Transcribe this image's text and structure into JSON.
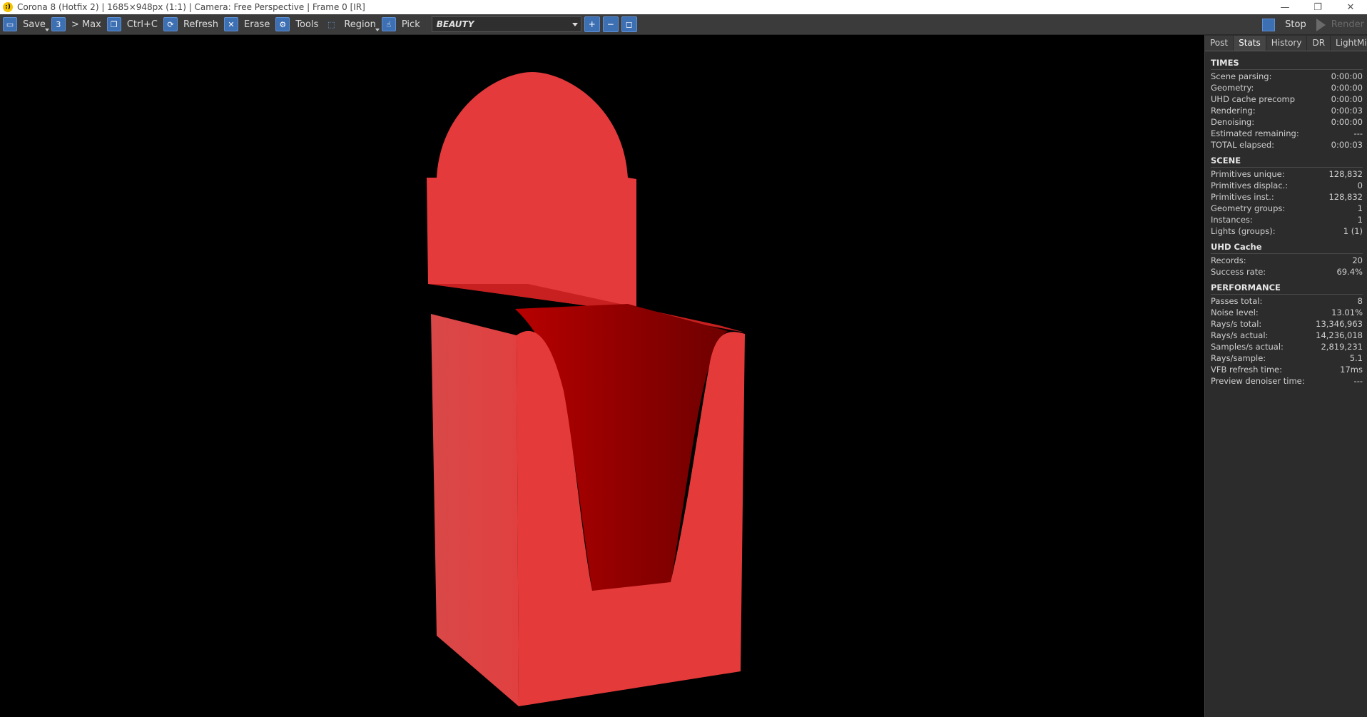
{
  "window": {
    "title": "Corona 8 (Hotfix 2) | 1685×948px (1:1) | Camera: Free Perspective | Frame 0 [IR]",
    "app_icon_glyph": ":)",
    "minimize": "—",
    "restore": "❐",
    "close": "✕"
  },
  "toolbar": {
    "save": "Save",
    "max": "> Max",
    "copy": "Ctrl+C",
    "refresh": "Refresh",
    "erase": "Erase",
    "tools": "Tools",
    "region": "Region",
    "pick": "Pick",
    "render_pass": "BEAUTY",
    "stop": "Stop",
    "render": "Render"
  },
  "tabs": [
    "Post",
    "Stats",
    "History",
    "DR",
    "LightMix"
  ],
  "active_tab": "Stats",
  "stats": {
    "times": {
      "title": "TIMES",
      "rows": [
        {
          "label": "Scene parsing:",
          "value": "0:00:00"
        },
        {
          "label": "Geometry:",
          "value": "0:00:00"
        },
        {
          "label": "UHD cache precomp",
          "value": "0:00:00"
        },
        {
          "label": "Rendering:",
          "value": "0:00:03"
        },
        {
          "label": "Denoising:",
          "value": "0:00:00"
        },
        {
          "label": "Estimated remaining:",
          "value": "---"
        },
        {
          "label": "TOTAL elapsed:",
          "value": "0:00:03"
        }
      ]
    },
    "scene": {
      "title": "SCENE",
      "rows": [
        {
          "label": "Primitives unique:",
          "value": "128,832"
        },
        {
          "label": "Primitives displac.:",
          "value": "0"
        },
        {
          "label": "Primitives inst.:",
          "value": "128,832"
        },
        {
          "label": "Geometry groups:",
          "value": "1"
        },
        {
          "label": "Instances:",
          "value": "1"
        },
        {
          "label": "Lights (groups):",
          "value": "1 (1)"
        }
      ]
    },
    "uhd": {
      "title": "UHD Cache",
      "rows": [
        {
          "label": "Records:",
          "value": "20"
        },
        {
          "label": "Success rate:",
          "value": "69.4%"
        }
      ]
    },
    "performance": {
      "title": "PERFORMANCE",
      "rows": [
        {
          "label": "Passes total:",
          "value": "8"
        },
        {
          "label": "Noise level:",
          "value": "13.01%"
        },
        {
          "label": "Rays/s total:",
          "value": "13,346,963"
        },
        {
          "label": "Rays/s actual:",
          "value": "14,236,018"
        },
        {
          "label": "Samples/s actual:",
          "value": "2,819,231"
        },
        {
          "label": "Rays/sample:",
          "value": "5.1"
        },
        {
          "label": "VFB refresh time:",
          "value": "17ms"
        },
        {
          "label": "Preview denoiser time:",
          "value": "---"
        }
      ]
    }
  },
  "colors": {
    "box_front": "#e53a3a",
    "box_side": "#dc4545",
    "box_inner": "#a00000",
    "box_back": "#e33a3a",
    "accent_blue": "#3d6fb3"
  }
}
